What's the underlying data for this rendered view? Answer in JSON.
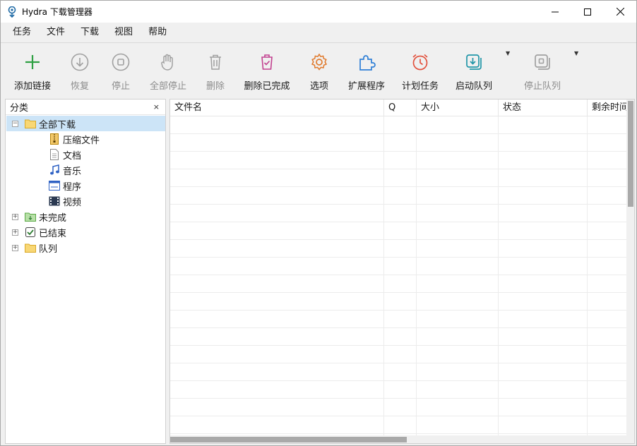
{
  "window": {
    "title": "Hydra 下载管理器",
    "icon": "app-logo-icon",
    "controls": [
      "minimize-icon",
      "maximize-icon",
      "close-icon"
    ]
  },
  "menu": [
    "任务",
    "文件",
    "下载",
    "视图",
    "帮助"
  ],
  "toolbar": {
    "add": "添加链接",
    "resume": "恢复",
    "stop": "停止",
    "stop_all": "全部停止",
    "delete": "删除",
    "delete_completed": "删除已完成",
    "options": "选项",
    "extensions": "扩展程序",
    "scheduler": "计划任务",
    "start_queue": "启动队列",
    "stop_queue": "停止队列"
  },
  "sidebar": {
    "title": "分类",
    "close": "×",
    "tree": {
      "all": "全部下载",
      "children": [
        "压缩文件",
        "文档",
        "音乐",
        "程序",
        "视频"
      ],
      "unfinished": "未完成",
      "finished": "已结束",
      "queues": "队列"
    }
  },
  "grid": {
    "columns": [
      "文件名",
      "Q",
      "大小",
      "状态",
      "剩余时间"
    ]
  },
  "colors": {
    "accent_green": "#2ea043",
    "selection": "#cce4f7",
    "disabled": "#8c8c8c"
  }
}
